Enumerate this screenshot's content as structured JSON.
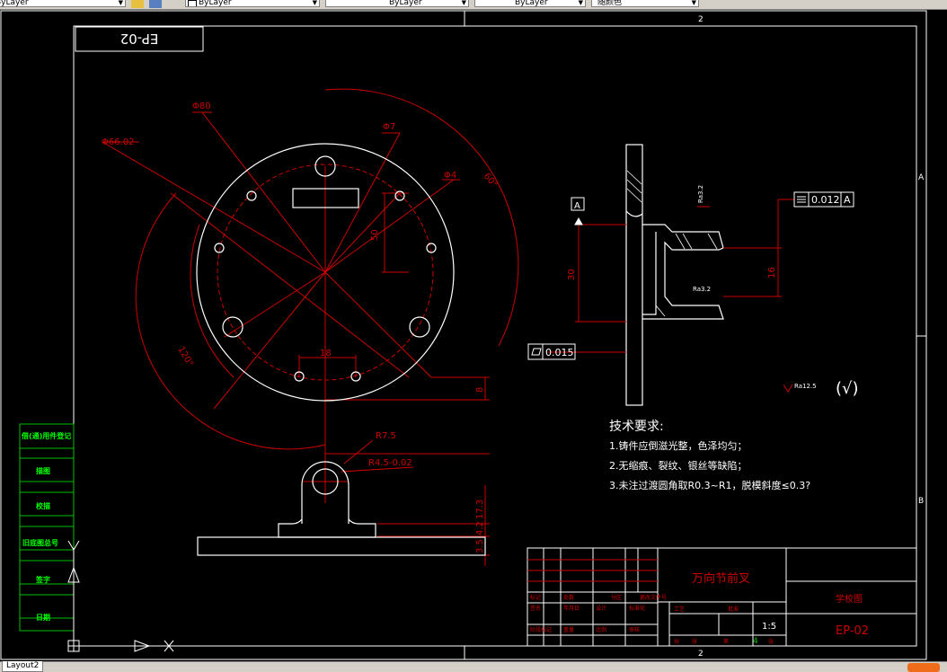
{
  "toolbar": {
    "layer_combo": "ByLayer",
    "linetype_combo": "ByLayer",
    "lineweight_combo": "ByLayer",
    "color_combo": "随颜色"
  },
  "layout_tab": "Layout2",
  "drawing": {
    "drawing_no_box": "EP-02",
    "dims": {
      "d80": "Φ80",
      "d66": "Φ66.02",
      "d7": "Φ7",
      "d4": "Φ4",
      "a60": "60°",
      "a120": "120°",
      "v50": "50",
      "h18": "18",
      "v8": "8",
      "r75": "R7.5",
      "r45": "R4.5-0.02",
      "v173": "17.3",
      "v42": "4.2",
      "v35": "3.5",
      "v30": "30",
      "v16": "16",
      "ra1": "Ra3.2",
      "ra2": "Ra3.2",
      "ra3": "Ra12.5"
    },
    "datum_letter": "A",
    "gdt_flatness": "0.015",
    "gdt_position_value": "0.012",
    "gdt_position_datum": "A",
    "roughness_general": "(√)",
    "tech_req": {
      "title": "技术要求:",
      "line1": "1.铸件应倒滋光整，色泽均匀；",
      "line2": "2.无缩痕、裂纹、银丝等缺陷；",
      "line3": "3.未注过渡圆角取R0.3~R1，脱模斜度≤0.3?"
    },
    "title_block": {
      "part_name": "万向节前叉",
      "company": "学校图",
      "drawing_no": "EP-02",
      "scale": "1:5",
      "sheet": "4",
      "cells": [
        "标记",
        "处数",
        "分区",
        "更改文件号",
        "签名",
        "年月日",
        "设计",
        "标准化",
        "阶段标记",
        "重量",
        "比例",
        "审核",
        "工艺",
        "批准",
        "共",
        "张",
        "第",
        "张"
      ]
    },
    "side_strip": {
      "s1": "借(通)用件登记",
      "s2": "描图",
      "s3": "校描",
      "s4": "旧底图总号",
      "s5": "签字",
      "s6": "日期"
    },
    "ucs": {
      "y": "Y",
      "x": "X"
    }
  },
  "colors": {
    "background": "#000000",
    "outline": "#ffffff",
    "dimension": "#cc0000",
    "dim_text": "#cc0000",
    "green": "#00c000",
    "yellow": "#ffff00",
    "toolbar": "#d4d0c8"
  }
}
